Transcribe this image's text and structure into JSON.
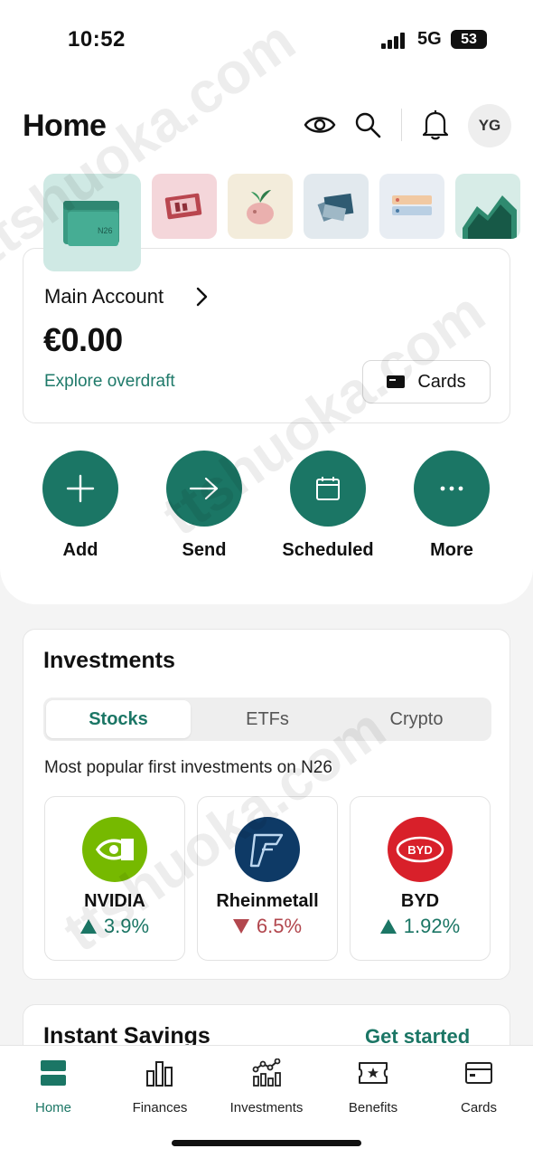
{
  "status_bar": {
    "time": "10:52",
    "network": "5G",
    "battery": "53"
  },
  "header": {
    "title": "Home",
    "avatar_initials": "YG",
    "icons": [
      "eye-icon",
      "search-icon",
      "bell-icon"
    ]
  },
  "account": {
    "name": "Main Account",
    "balance": "€0.00",
    "overdraft_link": "Explore overdraft",
    "cards_button": "Cards",
    "thumbnail_label": "N26"
  },
  "actions": [
    {
      "label": "Add",
      "icon": "plus-icon"
    },
    {
      "label": "Send",
      "icon": "arrow-right-icon"
    },
    {
      "label": "Scheduled",
      "icon": "calendar-icon"
    },
    {
      "label": "More",
      "icon": "more-dots-icon"
    }
  ],
  "investments": {
    "title": "Investments",
    "tabs": [
      "Stocks",
      "ETFs",
      "Crypto"
    ],
    "active_tab": "Stocks",
    "subtitle": "Most popular first investments on N26",
    "stocks": [
      {
        "name": "NVIDIA",
        "change": "3.9%",
        "direction": "up",
        "logo_color": "#76b900"
      },
      {
        "name": "Rheinmetall",
        "change": "6.5%",
        "direction": "down",
        "logo_color": "#0e3a66"
      },
      {
        "name": "BYD",
        "change": "1.92%",
        "direction": "up",
        "logo_color": "#d8202a",
        "logo_text": "BYD"
      }
    ]
  },
  "savings": {
    "title": "Instant Savings",
    "link": "Get started"
  },
  "bottom_nav": [
    {
      "label": "Home",
      "icon": "home-icon",
      "active": true
    },
    {
      "label": "Finances",
      "icon": "bar-chart-icon",
      "active": false
    },
    {
      "label": "Investments",
      "icon": "investments-icon",
      "active": false
    },
    {
      "label": "Benefits",
      "icon": "ticket-icon",
      "active": false
    },
    {
      "label": "Cards",
      "icon": "card-icon",
      "active": false
    }
  ],
  "colors": {
    "accent": "#1b7665",
    "down": "#b2474e"
  },
  "watermark": "ttshuoka.com"
}
